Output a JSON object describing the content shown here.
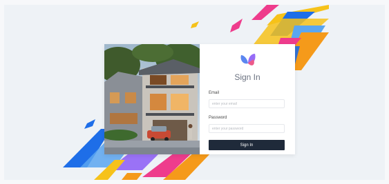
{
  "signin": {
    "title": "Sign In",
    "email_label": "Email",
    "email_placeholder": "enter your email",
    "email_value": "",
    "password_label": "Password",
    "password_placeholder": "enter your password",
    "password_value": "",
    "button_label": "Sign In"
  },
  "icons": {
    "logo": "butterfly-logo-icon"
  },
  "colors": {
    "button": "#1f2a3a",
    "background": "#eef2f6",
    "logo_blue": "#5b86f0",
    "logo_purple": "#8b5cf6",
    "logo_pink": "#ec5a8a",
    "stripe_orange": "#f59a1a",
    "stripe_yellow": "#f6c21a",
    "stripe_blue": "#1e6ee8",
    "stripe_pink": "#ee3c8c"
  }
}
